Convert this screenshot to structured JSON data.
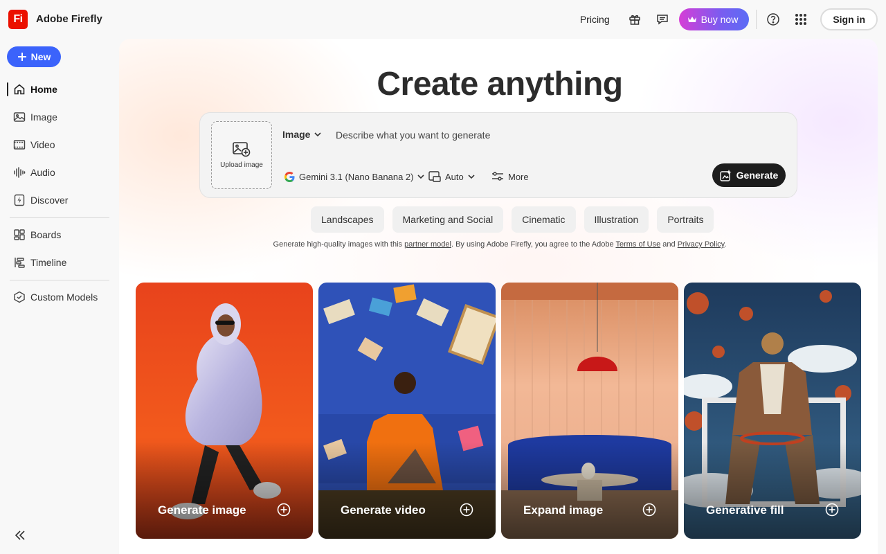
{
  "header": {
    "logo_text": "Fi",
    "brand": "Adobe Firefly",
    "pricing": "Pricing",
    "buy_now": "Buy now",
    "sign_in": "Sign in",
    "icons": [
      "gift-icon",
      "chat-icon",
      "crown-icon",
      "help-icon",
      "apps-grid-icon"
    ]
  },
  "sidebar": {
    "new_label": "New",
    "items": [
      {
        "label": "Home",
        "icon": "home-icon",
        "active": true
      },
      {
        "label": "Image",
        "icon": "image-icon"
      },
      {
        "label": "Video",
        "icon": "video-icon"
      },
      {
        "label": "Audio",
        "icon": "audio-icon"
      },
      {
        "label": "Discover",
        "icon": "discover-icon"
      },
      {
        "label": "Boards",
        "icon": "boards-icon"
      },
      {
        "label": "Timeline",
        "icon": "timeline-icon"
      },
      {
        "label": "Custom Models",
        "icon": "custom-models-icon"
      }
    ]
  },
  "main": {
    "title": "Create anything",
    "upload_label": "Upload image",
    "type_label": "Image",
    "prompt_placeholder": "Describe what you want to generate",
    "model_label": "Gemini 3.1 (Nano Banana 2)",
    "aspect_label": "Auto",
    "more_label": "More",
    "generate_label": "Generate",
    "chips": [
      "Landscapes",
      "Marketing and Social",
      "Cinematic",
      "Illustration",
      "Portraits"
    ],
    "legal": {
      "part1": "Generate high-quality images with this ",
      "link1": "partner model",
      "part2": ". By using Adobe Firefly, you agree to the Adobe ",
      "link2": "Terms of Use",
      "part3": " and ",
      "link3": "Privacy Policy",
      "part4": "."
    },
    "cards": [
      {
        "label": "Generate image"
      },
      {
        "label": "Generate video"
      },
      {
        "label": "Expand image"
      },
      {
        "label": "Generative fill"
      }
    ]
  },
  "colors": {
    "brand_red": "#eb1000",
    "new_button": "#3b63fb",
    "generate_button": "#1d1d1d"
  }
}
